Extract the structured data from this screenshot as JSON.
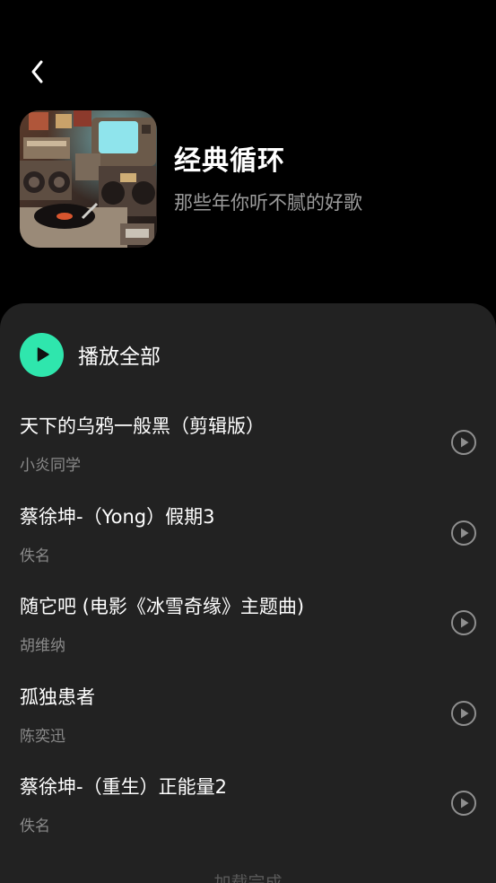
{
  "header": {
    "back_icon": "chevron-left-icon"
  },
  "playlist": {
    "title": "经典循环",
    "subtitle": "那些年你听不腻的好歌",
    "cover": "retro-music-cover-image"
  },
  "play_all": {
    "label": "播放全部",
    "icon": "play-icon",
    "accent": "#2fe6ad"
  },
  "songs": [
    {
      "title": "天下的乌鸦一般黑（剪辑版）",
      "artist": "小炎同学"
    },
    {
      "title": "蔡徐坤-（Yong）假期3",
      "artist": "佚名"
    },
    {
      "title": "随它吧 (电影《冰雪奇缘》主题曲)",
      "artist": "胡维纳"
    },
    {
      "title": "孤独患者",
      "artist": "陈奕迅"
    },
    {
      "title": "蔡徐坤-（重生）正能量2",
      "artist": "佚名"
    }
  ],
  "footer": {
    "text": "加载完成"
  },
  "colors": {
    "background": "#000000",
    "sheet": "#222222",
    "accent": "#2fe6ad"
  }
}
